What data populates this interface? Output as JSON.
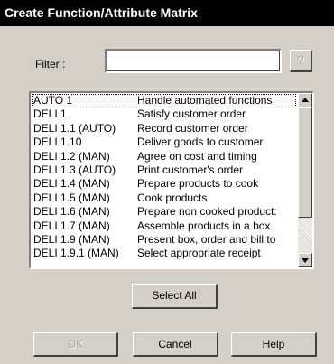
{
  "dialog": {
    "title": "Create Function/Attribute Matrix"
  },
  "filter": {
    "label": "Filter :",
    "value": "",
    "help_button_label": "?"
  },
  "list": {
    "items": [
      {
        "code": "AUTO 1",
        "description": "Handle automated functions",
        "selected": true
      },
      {
        "code": "DELI 1",
        "description": "Satisfy customer order"
      },
      {
        "code": "DELI 1.1 (AUTO)",
        "description": "Record customer order"
      },
      {
        "code": "DELI 1.10",
        "description": "Deliver goods to customer"
      },
      {
        "code": "DELI 1.2 (MAN)",
        "description": "Agree on cost and timing"
      },
      {
        "code": "DELI 1.3 (AUTO)",
        "description": "Print customer's order"
      },
      {
        "code": "DELI 1.4 (MAN)",
        "description": "Prepare products to cook"
      },
      {
        "code": "DELI 1.5 (MAN)",
        "description": "Cook products"
      },
      {
        "code": "DELI 1.6 (MAN)",
        "description": "Prepare non cooked product:"
      },
      {
        "code": "DELI 1.7 (MAN)",
        "description": "Assemble products in a box"
      },
      {
        "code": "DELI 1.9 (MAN)",
        "description": "Present box, order and bill to"
      },
      {
        "code": "DELI 1.9.1 (MAN)",
        "description": "Select appropriate receipt"
      }
    ]
  },
  "buttons": {
    "select_all": "Select All",
    "ok": "OK",
    "cancel": "Cancel",
    "help": "Help"
  }
}
